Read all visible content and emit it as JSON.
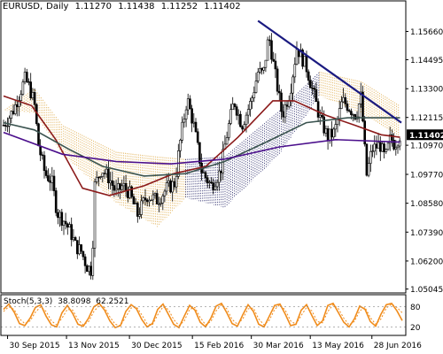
{
  "chart_data": [
    {
      "type": "candlestick",
      "symbol": "EURUSD",
      "timeframe": "Daily",
      "ohlc": {
        "open": "1.11270",
        "high": "1.11438",
        "low": "1.11252",
        "close": "1.11402"
      },
      "current_price_label": "1.11402",
      "y_ticks": [
        "1.15660",
        "1.14495",
        "1.13300",
        "1.12115",
        "1.10970",
        "1.09770",
        "1.08580",
        "1.07390",
        "1.06200",
        "1.05045"
      ],
      "ylim": [
        1.0503,
        1.167
      ],
      "x_tick_labels": [
        "30 Sep 2015",
        "13 Nov 2015",
        "30 Dec 2015",
        "15 Feb 2016",
        "30 Mar 2016",
        "13 May 2016",
        "28 Jun 2016"
      ],
      "x_ticks": [
        "2015-09-30",
        "2015-11-13",
        "2015-12-30",
        "2016-02-15",
        "2016-03-30",
        "2016-05-13",
        "2016-06-28"
      ],
      "x_range": [
        "2015-09-27",
        "2016-07-20"
      ],
      "candle_close_anchors": [
        [
          "2015-09-27",
          1.118
        ],
        [
          "2015-10-01",
          1.121
        ],
        [
          "2015-10-05",
          1.125
        ],
        [
          "2015-10-09",
          1.131
        ],
        [
          "2015-10-13",
          1.137
        ],
        [
          "2015-10-16",
          1.134
        ],
        [
          "2015-10-20",
          1.127
        ],
        [
          "2015-10-23",
          1.11
        ],
        [
          "2015-10-28",
          1.098
        ],
        [
          "2015-11-02",
          1.095
        ],
        [
          "2015-11-06",
          1.082
        ],
        [
          "2015-11-12",
          1.078
        ],
        [
          "2015-11-16",
          1.074
        ],
        [
          "2015-11-20",
          1.068
        ],
        [
          "2015-11-24",
          1.066
        ],
        [
          "2015-11-28",
          1.06
        ],
        [
          "2015-12-02",
          1.058
        ],
        [
          "2015-12-04",
          1.093
        ],
        [
          "2015-12-09",
          1.1
        ],
        [
          "2015-12-15",
          1.096
        ],
        [
          "2015-12-20",
          1.09
        ],
        [
          "2015-12-25",
          1.093
        ],
        [
          "2015-12-30",
          1.09
        ],
        [
          "2016-01-05",
          1.081
        ],
        [
          "2016-01-12",
          1.089
        ],
        [
          "2016-01-20",
          1.087
        ],
        [
          "2016-01-27",
          1.092
        ],
        [
          "2016-02-02",
          1.094
        ],
        [
          "2016-02-05",
          1.108
        ],
        [
          "2016-02-11",
          1.129
        ],
        [
          "2016-02-16",
          1.118
        ],
        [
          "2016-02-22",
          1.099
        ],
        [
          "2016-02-29",
          1.093
        ],
        [
          "2016-03-07",
          1.099
        ],
        [
          "2016-03-11",
          1.112
        ],
        [
          "2016-03-17",
          1.128
        ],
        [
          "2016-03-23",
          1.118
        ],
        [
          "2016-03-30",
          1.128
        ],
        [
          "2016-04-04",
          1.14
        ],
        [
          "2016-04-08",
          1.139
        ],
        [
          "2016-04-12",
          1.155
        ],
        [
          "2016-04-18",
          1.135
        ],
        [
          "2016-04-22",
          1.122
        ],
        [
          "2016-04-28",
          1.132
        ],
        [
          "2016-05-03",
          1.15
        ],
        [
          "2016-05-10",
          1.142
        ],
        [
          "2016-05-16",
          1.13
        ],
        [
          "2016-05-20",
          1.121
        ],
        [
          "2016-05-26",
          1.113
        ],
        [
          "2016-05-31",
          1.115
        ],
        [
          "2016-06-06",
          1.128
        ],
        [
          "2016-06-10",
          1.126
        ],
        [
          "2016-06-16",
          1.122
        ],
        [
          "2016-06-20",
          1.13
        ],
        [
          "2016-06-24",
          1.097
        ],
        [
          "2016-06-28",
          1.108
        ],
        [
          "2016-07-04",
          1.11
        ],
        [
          "2016-07-08",
          1.104
        ],
        [
          "2016-07-12",
          1.113
        ],
        [
          "2016-07-15",
          1.11
        ],
        [
          "2016-07-19",
          1.114
        ]
      ],
      "moving_averages": [
        {
          "color": "#8b1a1a",
          "points": [
            [
              "2015-09-27",
              1.13
            ],
            [
              "2015-10-18",
              1.126
            ],
            [
              "2015-11-05",
              1.112
            ],
            [
              "2015-11-25",
              1.092
            ],
            [
              "2015-12-15",
              1.089
            ],
            [
              "2016-01-10",
              1.093
            ],
            [
              "2016-02-01",
              1.098
            ],
            [
              "2016-02-25",
              1.101
            ],
            [
              "2016-03-20",
              1.113
            ],
            [
              "2016-04-15",
              1.128
            ],
            [
              "2016-05-01",
              1.128
            ],
            [
              "2016-05-25",
              1.122
            ],
            [
              "2016-06-15",
              1.118
            ],
            [
              "2016-07-05",
              1.114
            ],
            [
              "2016-07-19",
              1.113
            ]
          ]
        },
        {
          "color": "#3b5450",
          "points": [
            [
              "2015-09-27",
              1.119
            ],
            [
              "2015-10-20",
              1.116
            ],
            [
              "2015-11-15",
              1.108
            ],
            [
              "2015-12-10",
              1.101
            ],
            [
              "2016-01-10",
              1.097
            ],
            [
              "2016-02-10",
              1.098
            ],
            [
              "2016-03-10",
              1.103
            ],
            [
              "2016-04-10",
              1.111
            ],
            [
              "2016-05-10",
              1.119
            ],
            [
              "2016-06-10",
              1.121
            ],
            [
              "2016-07-19",
              1.121
            ]
          ]
        },
        {
          "color": "#4b0f8c",
          "points": [
            [
              "2015-09-27",
              1.115
            ],
            [
              "2015-11-10",
              1.106
            ],
            [
              "2015-12-20",
              1.103
            ],
            [
              "2016-01-30",
              1.102
            ],
            [
              "2016-03-10",
              1.104
            ],
            [
              "2016-04-20",
              1.109
            ],
            [
              "2016-06-01",
              1.112
            ],
            [
              "2016-07-19",
              1.111
            ]
          ]
        }
      ],
      "ichimoku_cloud": [
        {
          "color": "#e0ad4e",
          "upper": [
            [
              "2015-09-27",
              1.124
            ],
            [
              "2015-10-20",
              1.133
            ],
            [
              "2015-11-10",
              1.118
            ],
            [
              "2015-12-20",
              1.107
            ],
            [
              "2016-01-20",
              1.105
            ],
            [
              "2016-02-10",
              1.104
            ]
          ],
          "lower": [
            [
              "2015-09-27",
              1.124
            ],
            [
              "2015-10-20",
              1.123
            ],
            [
              "2015-11-10",
              1.106
            ],
            [
              "2015-12-20",
              1.086
            ],
            [
              "2016-01-20",
              1.076
            ],
            [
              "2016-02-10",
              1.088
            ]
          ]
        },
        {
          "color": "#2a2a6a",
          "upper": [
            [
              "2016-02-10",
              1.104
            ],
            [
              "2016-03-10",
              1.105
            ],
            [
              "2016-04-20",
              1.124
            ],
            [
              "2016-05-20",
              1.14
            ]
          ],
          "lower": [
            [
              "2016-02-10",
              1.088
            ],
            [
              "2016-03-10",
              1.084
            ],
            [
              "2016-04-20",
              1.106
            ],
            [
              "2016-05-20",
              1.13
            ]
          ]
        },
        {
          "color": "#e0ad4e",
          "upper": [
            [
              "2016-05-20",
              1.14
            ],
            [
              "2016-06-20",
              1.136
            ],
            [
              "2016-07-19",
              1.126
            ]
          ],
          "lower": [
            [
              "2016-05-20",
              1.13
            ],
            [
              "2016-06-20",
              1.123
            ],
            [
              "2016-07-19",
              1.113
            ]
          ]
        }
      ],
      "trendline": {
        "color": "#1a1a80",
        "points": [
          [
            "2016-04-04",
            1.161
          ],
          [
            "2016-07-20",
            1.119
          ]
        ]
      }
    },
    {
      "type": "line",
      "indicator": "Stoch",
      "label": "Stoch(5,3,3)",
      "main_value": "38.8098",
      "signal_value": "62.2521",
      "ylim": [
        0,
        100
      ],
      "y_ticks": [
        "80",
        "20"
      ],
      "series": [
        {
          "color": "#f08c1c",
          "values": [
            72,
            88,
            64,
            30,
            24,
            46,
            78,
            86,
            52,
            26,
            20,
            62,
            84,
            60,
            28,
            22,
            46,
            80,
            90,
            70,
            38,
            18,
            24,
            66,
            86,
            74,
            42,
            20,
            30,
            72,
            88,
            58,
            28,
            18,
            52,
            84,
            70,
            34,
            20,
            46,
            82,
            90,
            62,
            30,
            22,
            56,
            86,
            66,
            28,
            20,
            52,
            84,
            88,
            58,
            24,
            28,
            70,
            86,
            54,
            24,
            38,
            84,
            90,
            62,
            34,
            20,
            44,
            82,
            72,
            36,
            22,
            58,
            86,
            90,
            68,
            39
          ]
        },
        {
          "color": "#f08c1c",
          "dash": "2,2",
          "values": [
            66,
            80,
            72,
            44,
            30,
            38,
            64,
            80,
            66,
            38,
            26,
            46,
            72,
            70,
            42,
            26,
            36,
            66,
            84,
            78,
            50,
            28,
            24,
            50,
            76,
            80,
            56,
            30,
            26,
            56,
            80,
            72,
            42,
            24,
            38,
            72,
            78,
            48,
            26,
            36,
            68,
            86,
            74,
            42,
            28,
            44,
            74,
            76,
            44,
            26,
            40,
            72,
            86,
            70,
            38,
            28,
            54,
            78,
            68,
            36,
            32,
            66,
            86,
            74,
            46,
            26,
            36,
            68,
            78,
            48,
            28,
            44,
            76,
            88,
            78,
            62
          ]
        }
      ]
    }
  ]
}
